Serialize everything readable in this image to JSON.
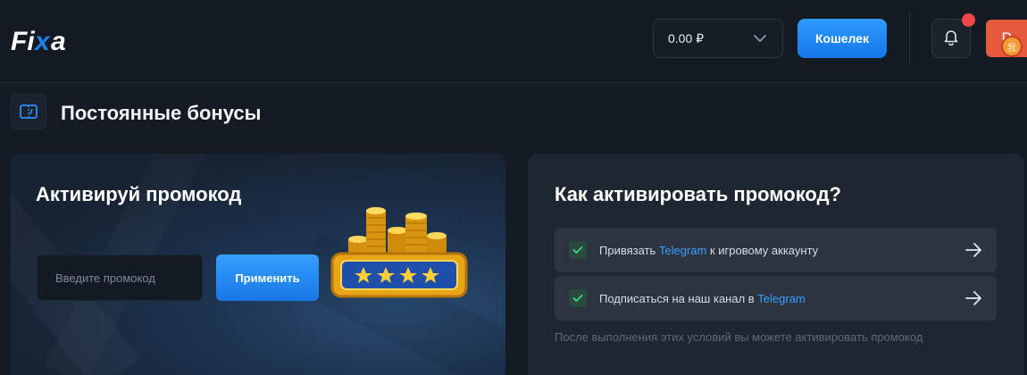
{
  "header": {
    "logo_text": "Fixa",
    "balance": "0.00 ₽",
    "wallet_label": "Кошелек",
    "avatar_letter": "Р",
    "avatar_badge": "我"
  },
  "section": {
    "title": "Постоянные бонусы"
  },
  "promo_card": {
    "title": "Активируй промокод",
    "input_placeholder": "Введите промокод",
    "apply_label": "Применить"
  },
  "howto_card": {
    "title": "Как активировать промокод?",
    "steps": [
      {
        "prefix": "Привязать ",
        "link": "Telegram",
        "suffix": " к игровому аккаунту"
      },
      {
        "prefix": "Подписаться на наш канал в ",
        "link": "Telegram",
        "suffix": ""
      }
    ],
    "note": "После выполнения этих условий вы можете активировать промокод"
  },
  "icons": {
    "logo": "fixa-logo",
    "dropdown": "chevron-down-icon",
    "bell": "bell-icon",
    "section": "ticket-icon",
    "check": "check-icon",
    "arrow": "arrow-right-icon"
  },
  "colors": {
    "accent": "#1f86f5",
    "background": "#151b24",
    "card": "#1e2631",
    "notification": "#f04848",
    "avatar": "#e45a3d"
  }
}
